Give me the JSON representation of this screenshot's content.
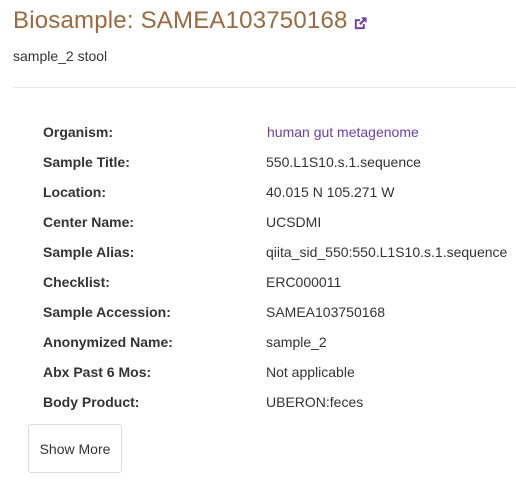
{
  "header": {
    "title": "Biosample: SAMEA103750168",
    "external_link_icon": "external-link-icon",
    "subtitle": "sample_2 stool"
  },
  "colors": {
    "title": "#9b6a3f",
    "link": "#6b3fa0",
    "text": "#333333"
  },
  "attributes": [
    {
      "key": "Organism:",
      "value": "human gut metagenome",
      "is_link": true
    },
    {
      "key": "Sample Title:",
      "value": "550.L1S10.s.1.sequence"
    },
    {
      "key": "Location:",
      "value": "40.015 N 105.271 W"
    },
    {
      "key": "Center Name:",
      "value": "UCSDMI"
    },
    {
      "key": "Sample Alias:",
      "value": "qiita_sid_550:550.L1S10.s.1.sequence"
    },
    {
      "key": "Checklist:",
      "value": "ERC000011"
    },
    {
      "key": "Sample Accession:",
      "value": "SAMEA103750168"
    },
    {
      "key": "Anonymized Name:",
      "value": "sample_2"
    },
    {
      "key": "Abx Past 6 Mos:",
      "value": "Not applicable"
    },
    {
      "key": "Body Product:",
      "value": "UBERON:feces"
    }
  ],
  "show_more_label": "Show More"
}
